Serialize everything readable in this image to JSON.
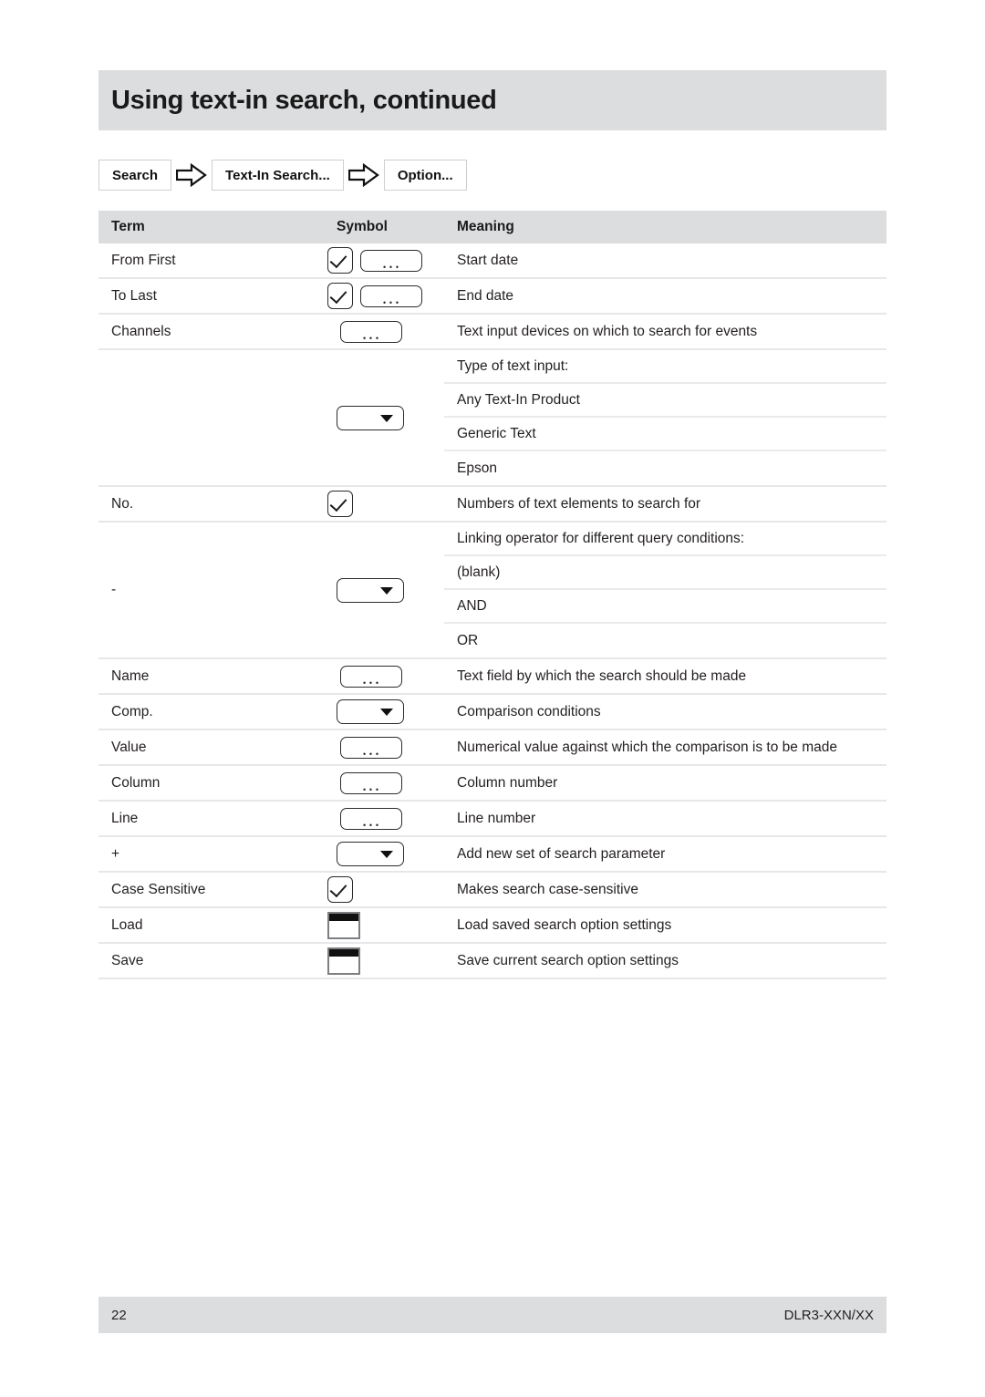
{
  "header": {
    "title": "Using text-in search, continued"
  },
  "breadcrumb": {
    "items": [
      {
        "label": "Search"
      },
      {
        "label": "Text-In Search..."
      },
      {
        "label": "Option..."
      }
    ],
    "arrow_icon": "arrow-right-icon"
  },
  "table": {
    "columns": [
      "Term",
      "Symbol",
      "Meaning"
    ],
    "rows": [
      {
        "term": "From First",
        "symbols": [
          "checkbox-icon",
          "ellipsis-button-icon"
        ],
        "meaning": "Start date"
      },
      {
        "term": "To Last",
        "symbols": [
          "checkbox-icon",
          "ellipsis-button-icon"
        ],
        "meaning": "End date"
      },
      {
        "term": "Channels",
        "symbols": [
          "ellipsis-button-icon"
        ],
        "meaning": "Text input devices on which to search for events"
      },
      {
        "term": "",
        "symbols": [
          "dropdown-button-icon"
        ],
        "meanings": [
          "Type of text input:",
          "Any Text-In Product",
          "Generic Text",
          "Epson"
        ]
      },
      {
        "term": "No.",
        "symbols": [
          "checkbox-icon"
        ],
        "meaning": "Numbers of text elements to search for"
      },
      {
        "term": "-",
        "symbols": [
          "dropdown-button-icon"
        ],
        "meanings": [
          "Linking operator for different query conditions:",
          "(blank)",
          "AND",
          "OR"
        ]
      },
      {
        "term": "Name",
        "symbols": [
          "ellipsis-button-icon"
        ],
        "meaning": "Text field by which the search should be made"
      },
      {
        "term": "Comp.",
        "symbols": [
          "dropdown-button-icon"
        ],
        "meaning": "Comparison conditions"
      },
      {
        "term": "Value",
        "symbols": [
          "ellipsis-button-icon"
        ],
        "meaning": "Numerical value against which the comparison is to be made"
      },
      {
        "term": "Column",
        "symbols": [
          "ellipsis-button-icon"
        ],
        "meaning": "Column number"
      },
      {
        "term": "Line",
        "symbols": [
          "ellipsis-button-icon"
        ],
        "meaning": "Line number"
      },
      {
        "term": "+",
        "symbols": [
          "dropdown-button-icon"
        ],
        "meaning": "Add new set of search parameter"
      },
      {
        "term": "Case Sensitive",
        "symbols": [
          "checkbox-icon"
        ],
        "meaning": "Makes search case-sensitive"
      },
      {
        "term": "Load",
        "symbols": [
          "file-button-icon"
        ],
        "meaning": "Load saved search option settings"
      },
      {
        "term": "Save",
        "symbols": [
          "file-button-icon"
        ],
        "meaning": "Save current search option settings"
      }
    ]
  },
  "footer": {
    "page_number": "22",
    "model": "DLR3-XXN/XX"
  },
  "colors": {
    "band": "#dcdddf",
    "rule": "#e6e7e8",
    "text": "#231f20"
  }
}
